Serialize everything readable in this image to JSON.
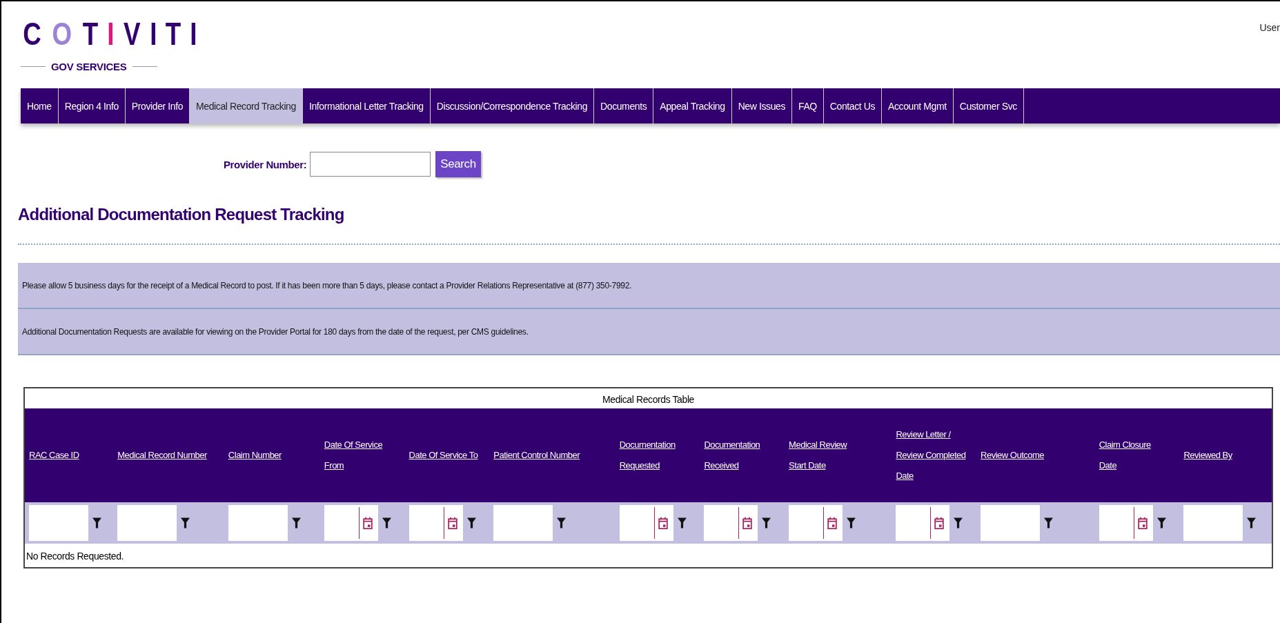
{
  "logo": {
    "letters": [
      {
        "char": "C",
        "color": "#33006f"
      },
      {
        "char": "O",
        "color": "#9b84d6"
      },
      {
        "char": "T",
        "color": "#33006f"
      },
      {
        "char": "I",
        "color": "#e0157f"
      },
      {
        "char": "V",
        "color": "#33006f"
      },
      {
        "char": "I",
        "color": "#33006f"
      },
      {
        "char": "T",
        "color": "#33006f"
      },
      {
        "char": "I",
        "color": "#33006f"
      }
    ],
    "tagline": "GOV SERVICES"
  },
  "user_label": "User",
  "nav": [
    {
      "label": "Home",
      "selected": false
    },
    {
      "label": "Region 4 Info",
      "selected": false
    },
    {
      "label": "Provider Info",
      "selected": false
    },
    {
      "label": "Medical Record Tracking",
      "selected": true
    },
    {
      "label": "Informational Letter Tracking",
      "selected": false
    },
    {
      "label": "Discussion/Correspondence Tracking",
      "selected": false
    },
    {
      "label": "Documents",
      "selected": false
    },
    {
      "label": "Appeal Tracking",
      "selected": false
    },
    {
      "label": "New Issues",
      "selected": false
    },
    {
      "label": "FAQ",
      "selected": false
    },
    {
      "label": "Contact Us",
      "selected": false
    },
    {
      "label": "Account Mgmt",
      "selected": false
    },
    {
      "label": "Customer Svc",
      "selected": false
    }
  ],
  "search": {
    "label": "Provider Number:",
    "button": "Search"
  },
  "heading": "Additional Documentation Request Tracking",
  "notices": [
    "Please allow 5 business days for the receipt of a Medical Record to post. If it has been more than 5 days, please contact a Provider Relations Representative at (877) 350-7992.",
    "Additional Documentation Requests are available for viewing on the Provider Portal for 180 days from the date of the request, per CMS guidelines."
  ],
  "table": {
    "caption": "Medical Records Table",
    "columns": [
      {
        "label": "RAC Case ID",
        "kind": "text"
      },
      {
        "label": "Medical Record Number",
        "kind": "text"
      },
      {
        "label": "Claim Number",
        "kind": "text"
      },
      {
        "label": "Date Of Service From",
        "kind": "date"
      },
      {
        "label": "Date Of Service To",
        "kind": "date"
      },
      {
        "label": "Patient Control Number",
        "kind": "text"
      },
      {
        "label": "Documentation Requested",
        "kind": "date"
      },
      {
        "label": "Documentation Received",
        "kind": "date"
      },
      {
        "label": "Medical Review Start Date",
        "kind": "date"
      },
      {
        "label": "Review Letter / Review Completed Date",
        "kind": "date"
      },
      {
        "label": "Review Outcome",
        "kind": "text"
      },
      {
        "label": "Claim Closure Date",
        "kind": "date"
      },
      {
        "label": "Reviewed By",
        "kind": "text"
      }
    ],
    "empty_message": "No Records Requested."
  }
}
